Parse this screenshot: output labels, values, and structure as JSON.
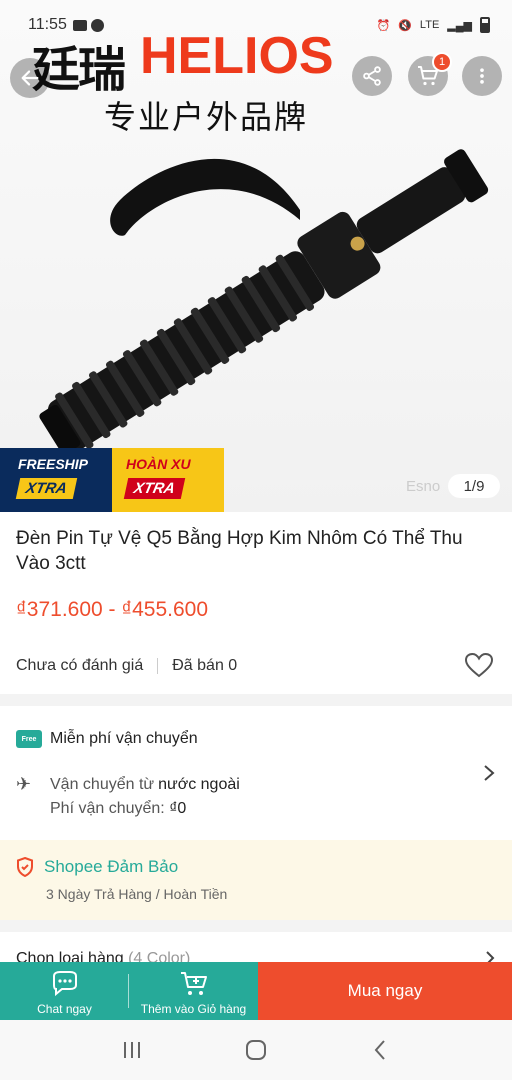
{
  "status_bar": {
    "time": "11:55",
    "network": "LTE"
  },
  "hero": {
    "brand_cn": "廷瑞",
    "brand_en": "HELIOS",
    "brand_tagline": "专业户外品牌",
    "cart_badge": "1",
    "image_counter": "1/9",
    "watermark": "Esno",
    "promo_freeship_line1": "FREESHIP",
    "promo_freeship_line2": "XTRA",
    "promo_coin_line1": "HOÀN XU",
    "promo_coin_line2": "XTRA"
  },
  "product": {
    "title": "Đèn Pin Tự Vệ Q5 Bằng Hợp Kim Nhôm Có Thể Thu Vào 3ctt",
    "price": "₫371.600 - ₫455.600",
    "rating_text": "Chưa có đánh giá",
    "sold_text": "Đã bán 0"
  },
  "shipping": {
    "free_label": "Miễn phí vận chuyển",
    "truck_tag": "Free",
    "from_prefix": "Vận chuyển từ",
    "from_value": "nước ngoài",
    "fee_prefix": "Phí vận chuyển:",
    "fee_value": "₫0"
  },
  "guarantee": {
    "title": "Shopee Đảm Bảo",
    "subtitle": "3 Ngày Trả Hàng / Hoàn Tiền"
  },
  "variant": {
    "label": "Chọn loại hàng",
    "count": "(4 Color)"
  },
  "action_bar": {
    "chat_label": "Chat ngay",
    "cart_label": "Thêm vào Giỏ hàng",
    "buy_label": "Mua ngay"
  },
  "colors": {
    "brand": "#ee4d2d",
    "teal": "#26aa99"
  }
}
